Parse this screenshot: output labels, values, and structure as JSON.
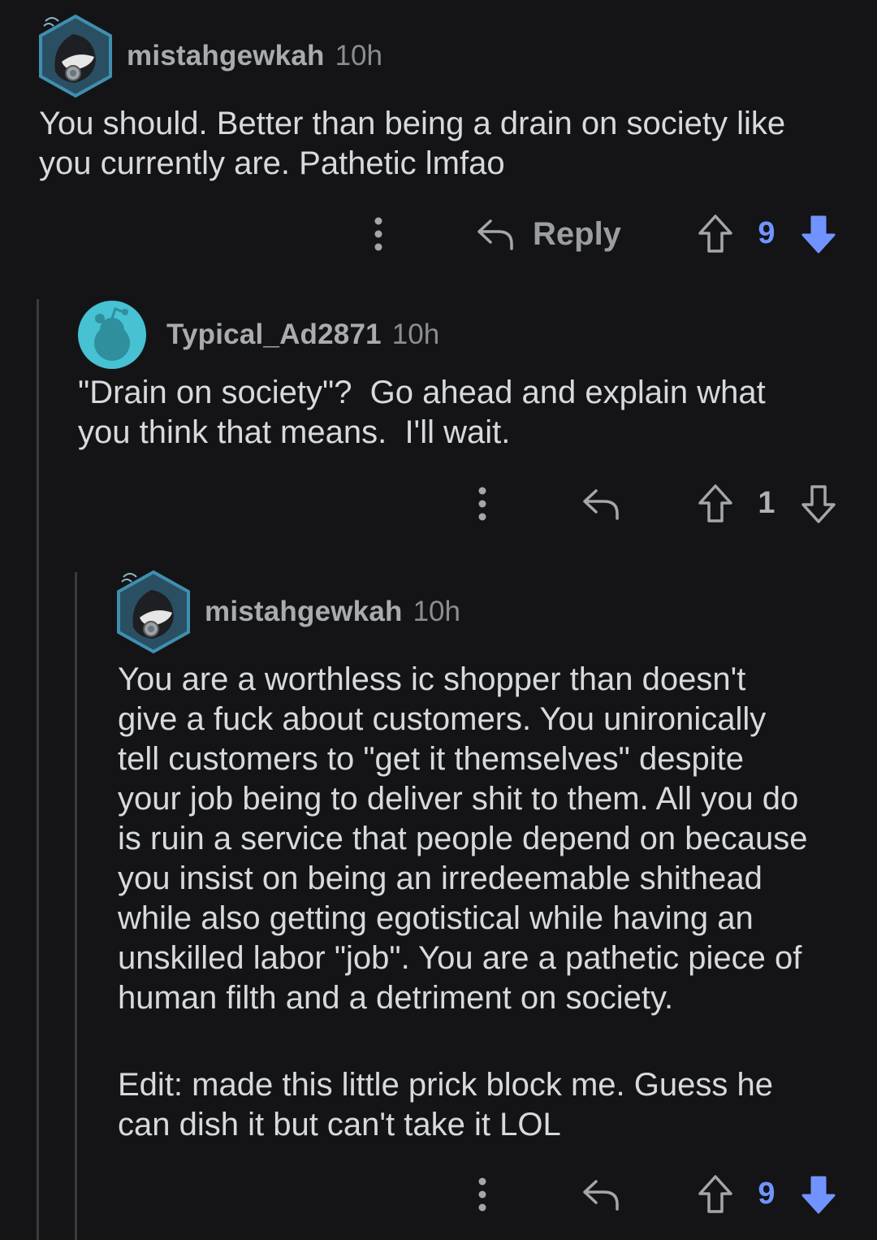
{
  "colors": {
    "background": "#141416",
    "thread_line": "#3a3b3d",
    "downvote_active": "#7193ff",
    "text": "#d7dadc",
    "muted": "#8b8e90"
  },
  "comments": [
    {
      "username": "mistahgewkah",
      "time": "10h",
      "body": "You should. Better than being a drain on society like\nyou currently are. Pathetic lmfao",
      "reply_label": "Reply",
      "score": "9",
      "vote_state": "downvoted",
      "avatar_icon": "snoo-gas-mask-avatar-icon"
    },
    {
      "username": "Typical_Ad2871",
      "time": "10h",
      "body": "\"Drain on society\"?  Go ahead and explain what\nyou think that means.  I'll wait.",
      "score": "1",
      "vote_state": "none",
      "avatar_icon": "default-snoo-avatar-icon"
    },
    {
      "username": "mistahgewkah",
      "time": "10h",
      "body": "You are a worthless ic shopper than doesn't\ngive a fuck about customers. You unironically\ntell customers to \"get it themselves\" despite\nyour job being to deliver shit to them. All you do\nis ruin a service that people depend on because\nyou insist on being an irredeemable shithead\nwhile also getting egotistical while having an\nunskilled labor \"job\". You are a pathetic piece of\nhuman filth and a detriment on society.",
      "edit": "Edit: made this little prick block me. Guess he\ncan dish it but can't take it LOL",
      "score": "9",
      "vote_state": "downvoted",
      "avatar_icon": "snoo-gas-mask-avatar-icon"
    }
  ]
}
